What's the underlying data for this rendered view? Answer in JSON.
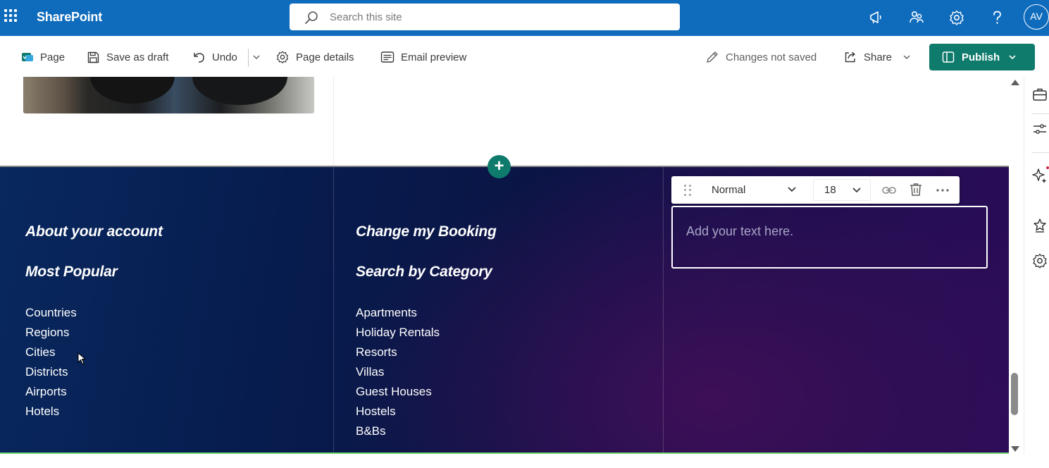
{
  "suite": {
    "brand": "SharePoint",
    "search_placeholder": "Search this site",
    "avatar_initials": "AV",
    "accent": "#0f6cbd"
  },
  "commandbar": {
    "page_label": "Page",
    "save_draft_label": "Save as draft",
    "undo_label": "Undo",
    "page_details_label": "Page details",
    "email_preview_label": "Email preview",
    "status_label": "Changes not saved",
    "share_label": "Share",
    "publish_label": "Publish",
    "publish_color": "#0f7b6c"
  },
  "footer_section": {
    "col1": {
      "heading1": "About your account",
      "heading2": "Most Popular",
      "links": [
        "Countries",
        "Regions",
        "Cities",
        "Districts",
        "Airports",
        "Hotels"
      ]
    },
    "col2": {
      "heading1": "Change my Booking",
      "heading2": "Search by Category",
      "links": [
        "Apartments",
        "Holiday Rentals",
        "Resorts",
        "Villas",
        "Guest Houses",
        "Hostels",
        "B&Bs"
      ]
    },
    "col3": {
      "text_style": "Normal",
      "font_size": "18",
      "text_placeholder": "Add your text here."
    }
  },
  "icons": {
    "waffle": "app-launcher-icon",
    "megaphone": "megaphone-icon",
    "feedback": "people-icon",
    "settings": "gear-icon",
    "help": "question-icon"
  }
}
